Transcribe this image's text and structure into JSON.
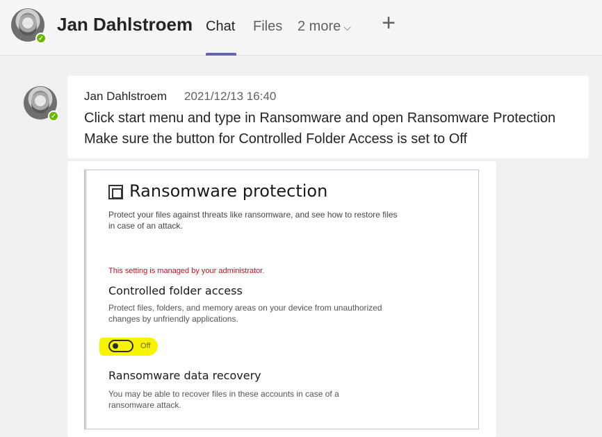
{
  "header": {
    "title": "Jan Dahlstroem",
    "tabs": [
      {
        "label": "Chat",
        "active": true
      },
      {
        "label": "Files",
        "active": false
      },
      {
        "label": "2 more",
        "active": false
      }
    ],
    "add_tab_icon": "plus-icon",
    "accent_color": "#6264a7"
  },
  "message": {
    "sender": "Jan Dahlstroem",
    "timestamp": "2021/12/13 16:40",
    "lines": [
      "Click start menu and type in Ransomware and open Ransomware Protection",
      "Make sure the button for Controlled Folder Access is set to Off"
    ],
    "presence_color": "#6bb700"
  },
  "attachment": {
    "title": "Ransomware protection",
    "description": "Protect your files against threats like ransomware, and see how to restore files in case of an attack.",
    "admin_notice": "This setting is managed by your administrator.",
    "cfa_heading": "Controlled folder access",
    "cfa_description": "Protect files, folders, and memory areas on your device from unauthorized changes by unfriendly applications.",
    "toggle_state": "Off",
    "recovery_heading": "Ransomware data recovery",
    "recovery_description": "You may be able to recover files in these accounts in case of a ransomware attack.",
    "highlight_color": "#f8f400",
    "admin_notice_color": "#c50f1f"
  }
}
